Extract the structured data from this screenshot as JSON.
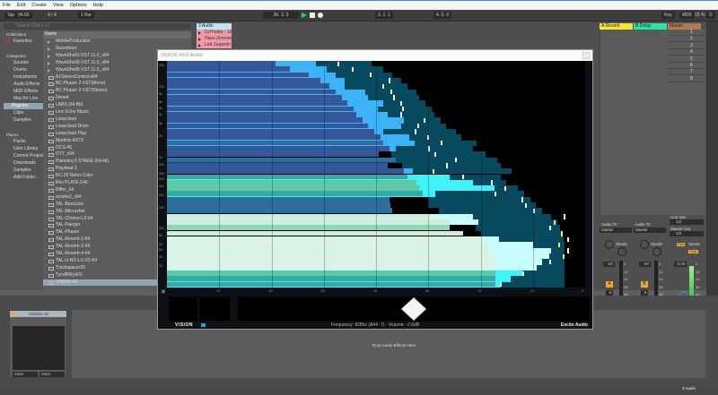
{
  "menu": [
    "File",
    "Edit",
    "Create",
    "View",
    "Options",
    "Help"
  ],
  "toolbar": {
    "tap": "Tap",
    "tempo": "94.65",
    "signature": "4 / 4",
    "quantize": "1 Bar",
    "position": "36. 3. 3",
    "loop_start": "3. 1. 1",
    "loop_length": "4. 0. 0",
    "key": "Key",
    "midi": "MIDI",
    "cpu": "15 %",
    "disk": "D"
  },
  "browser": {
    "search_placeholder": "Search (Ctrl + F)",
    "collections_header": "Collections",
    "favorites": "Favorites",
    "categories_header": "Categories",
    "categories": [
      "Sounds",
      "Drums",
      "Instruments",
      "Audio Effects",
      "MIDI Effects",
      "Max for Live",
      "Plug-Ins",
      "Clips",
      "Samples"
    ],
    "places_header": "Places",
    "places": [
      "Packs",
      "User Library",
      "Current Project",
      "Downloads",
      "Samples",
      "Add Folder..."
    ],
    "name_header": "Name",
    "folders": [
      "MobileProduction",
      "Soundtoys",
      "WaveShell1-VST 11.0_x64",
      "WaveShell3-VST 11.0_x64",
      "WaveShell5-VST 11.0_x64"
    ],
    "plugins": [
      "A1StereoControl-x64",
      "BC Phaser 3 VST(Mono)",
      "BC Phaser 3 VST(Stereo)",
      "Dexed",
      "LABS (64 Bit)",
      "Lem Echo Music",
      "Loopcloud",
      "Loopcloud Drum",
      "Loopcloud Play",
      "Martinic AX73",
      "OCS-45",
      "OTT_x64",
      "Pianoteq 6 STAGE (64-bit)",
      "Playbeat 3",
      "RC-20 Retro Color",
      "Rev PLATE-140",
      "Riffer_64",
      "soothe2_x64",
      "TAL-BassLine",
      "TAL-Bitcrusher",
      "TAL-Chorus-LX-64",
      "TAL-Flanger",
      "TAL-Phaser",
      "TAL-Reverb-2-64",
      "TAL-Reverb-3-64",
      "TAL-Reverb-4-64",
      "TAL-U-NO-LX-V2-64",
      "Trackspacer25",
      "TyrellN6(x64)",
      "VISION 4X"
    ],
    "selected_plugin": "VISION 4X"
  },
  "session": {
    "track": "3 Audio",
    "clips": [
      "Dj Pooka - 12. Ni",
      "Hans Zimmer - 0",
      "Led Zeppelin - 0"
    ],
    "returns": [
      {
        "name": "A Reverb",
        "color": "#f5e53a"
      },
      {
        "name": "B Delay",
        "color": "#2fe0a8"
      },
      {
        "name": "Master",
        "color": "#b07b52"
      }
    ],
    "scenes": [
      "1",
      "2",
      "3",
      "4",
      "5",
      "6",
      "7",
      "8"
    ]
  },
  "mixer": {
    "audio_to": "Audio To",
    "master": "Master",
    "sends": "Sends",
    "cue_out": "Cue Out",
    "cue_val": "1/2",
    "master_out": "Master Out",
    "master_val": "1/2",
    "vol_a": "-Inf",
    "vol_b": "-Inf",
    "vol_m": "0.00",
    "btn_a": "A",
    "btn_b": "B",
    "solo": "S",
    "scale": [
      "0",
      "12",
      "24",
      "36",
      "48",
      "60"
    ],
    "send_a": "A",
    "send_b": "B",
    "post1": "Post",
    "post2": "Post"
  },
  "plugin": {
    "title": "VISION 4X/3 Audio",
    "status": "Frequency: 828hz (A#4 -7) - Volume: -2.6dB",
    "brand": "Excite Audio",
    "logo": "VISION",
    "freq_labels": [
      [
        "20k",
        20000
      ],
      [
        "10k",
        10000
      ],
      [
        "8k",
        8000
      ],
      [
        "6k",
        6000
      ],
      [
        "5k",
        5000
      ],
      [
        "4k",
        4000
      ],
      [
        "3k",
        3000
      ],
      [
        "2k",
        2000
      ],
      [
        "1k",
        1000
      ],
      [
        "800",
        800
      ],
      [
        "600",
        600
      ],
      [
        "500",
        500
      ],
      [
        "400",
        400
      ],
      [
        "300",
        300
      ],
      [
        "200",
        200
      ],
      [
        "100",
        100
      ],
      [
        "80",
        80
      ],
      [
        "60",
        60
      ],
      [
        "50",
        50
      ],
      [
        "40",
        40
      ],
      [
        "30",
        30
      ]
    ],
    "db_labels": [
      "-70",
      "-60",
      "-50",
      "-40",
      "-30",
      "-20",
      "-10",
      "0"
    ]
  },
  "chart_data": {
    "type": "bar",
    "orientation": "horizontal",
    "xlim": [
      -80,
      0
    ],
    "xlabel": "dB",
    "ylabel": "Frequency",
    "colors": {
      "blue": "#36579a",
      "steel": "#2e6e9e",
      "teal": "#37a9a6",
      "green": "#5ec9a6",
      "mint": "#8ed7b6",
      "pale": "#cdeed8",
      "paler": "#dcf2e4",
      "env": "#07495f",
      "bright_blue": "#3db2f7",
      "bright_cyan": "#3ef2f8",
      "bright_pale": "#c9fcfd",
      "marker": "#ffffff",
      "marker_hot": "#f2e07a"
    },
    "row_fields": [
      "color",
      "level",
      "bright",
      "peak_env",
      "hold",
      "env_start"
    ],
    "rows": [
      [
        "blue",
        -59.2,
        -51.5,
        -40.9,
        -47.2,
        0
      ],
      [
        "blue",
        -56.4,
        -49.5,
        -38.6,
        -44.5,
        0
      ],
      [
        "blue",
        -52.9,
        -47.8,
        -36.9,
        -41,
        0
      ],
      [
        "blue",
        -50.6,
        -46,
        -35.2,
        -37.5,
        0
      ],
      [
        "blue",
        -48.9,
        -46,
        -34,
        -38.7,
        0
      ],
      [
        "blue",
        -47.8,
        -42,
        -32.3,
        -37,
        0
      ],
      [
        "blue",
        -46.6,
        -41.5,
        -31.7,
        -36.6,
        0
      ],
      [
        "blue",
        -45.5,
        -38.6,
        -30.6,
        -35.2,
        0
      ],
      [
        "blue",
        -44.3,
        -39.7,
        -29.4,
        -34.9,
        0
      ],
      [
        "blue",
        -43.8,
        -37.7,
        -28.9,
        -35.2,
        0
      ],
      [
        "blue",
        -42.6,
        -34.6,
        -27.7,
        -30.7,
        0
      ],
      [
        "blue",
        -41.5,
        -35.2,
        -26.6,
        -31.9,
        0
      ],
      [
        "blue",
        -40.3,
        -38.6,
        -24.8,
        -32.5,
        0
      ],
      [
        "blue",
        -39.2,
        -33.7,
        -23.7,
        -30,
        0
      ],
      [
        "steel",
        -38.6,
        -32.6,
        -20.8,
        -27.4,
        0
      ],
      [
        "blue",
        -37.5,
        -36.3,
        -21.4,
        -29.8,
        0
      ],
      [
        "blue",
        -39.5,
        null,
        -19.1,
        -28.7,
        -37
      ],
      [
        "steel",
        -36.3,
        null,
        -16.8,
        -24.7,
        0
      ],
      [
        "blue",
        -37.7,
        null,
        -16.2,
        -26.4,
        -35
      ],
      [
        "blue",
        -34.6,
        -33,
        -14,
        -29,
        0
      ],
      [
        "teal",
        -34,
        -26,
        -16.2,
        -23.4,
        0
      ],
      [
        "green",
        -32.3,
        -21.4,
        -15.1,
        -17.9,
        0
      ],
      [
        "green",
        -31.7,
        -17.4,
        -12.8,
        -15.2,
        0
      ],
      [
        "teal",
        -31.1,
        -28.6,
        -11.7,
        -17.2,
        0
      ],
      [
        "steel",
        -37.5,
        null,
        -10.5,
        -12,
        -30
      ],
      [
        "steel",
        -37.2,
        null,
        -9.4,
        -11.4,
        -30
      ],
      [
        "steel",
        -36.9,
        null,
        -8.2,
        -9.8,
        -28
      ],
      [
        "pale",
        -30,
        -21.4,
        -6.5,
        -3.9,
        0
      ],
      [
        "pale",
        -26,
        -20.5,
        -5.4,
        -5.9,
        0
      ],
      [
        "mint",
        -26,
        null,
        -4.8,
        -6.7,
        -21
      ],
      [
        "pale",
        -23.4,
        null,
        -4.5,
        -4.5,
        -20
      ],
      [
        "paler",
        -20,
        -16.5,
        -4.2,
        -3.2,
        0
      ],
      [
        "paler",
        -18.5,
        -10,
        -3.9,
        -4.9,
        0
      ],
      [
        "paler",
        -18,
        -6.5,
        -3.9,
        -3.2,
        0
      ],
      [
        "paler",
        -17.5,
        -6.8,
        -3.9,
        -4.2,
        0
      ],
      [
        "paler",
        -17.5,
        -8.2,
        -3.9,
        -6.7,
        0
      ],
      [
        "paler",
        -17.2,
        -9.4,
        -3.9,
        -9.4,
        0
      ],
      [
        "green",
        -17.2,
        -12,
        -3.9,
        -11.8,
        0
      ],
      [
        "teal",
        -17.2,
        -14.2,
        -3.9,
        null,
        0
      ],
      [
        "teal",
        -17.2,
        -16.2,
        -3.9,
        -16.2,
        0
      ]
    ]
  },
  "device": {
    "name": "VISION 4X",
    "sidechain_a": "none",
    "sidechain_b": "none",
    "drop_hint": "Drop Audio Effects Here"
  },
  "status": {
    "track": "3 Audio"
  }
}
